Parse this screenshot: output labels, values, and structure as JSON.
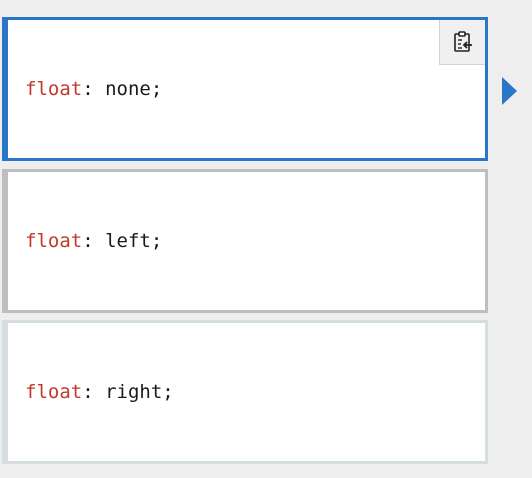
{
  "examples": [
    {
      "property": "float",
      "separator": ": ",
      "value": "none;",
      "selected": true
    },
    {
      "property": "float",
      "separator": ": ",
      "value": "left;",
      "selected": false
    },
    {
      "property": "float",
      "separator": ": ",
      "value": "right;",
      "selected": false
    }
  ],
  "icons": {
    "copy": "clipboard-paste-icon",
    "selection_indicator": "caret-right-icon"
  },
  "colors": {
    "accent": "#2b76c6",
    "property": "#c0392b",
    "background": "#eeeeee"
  }
}
